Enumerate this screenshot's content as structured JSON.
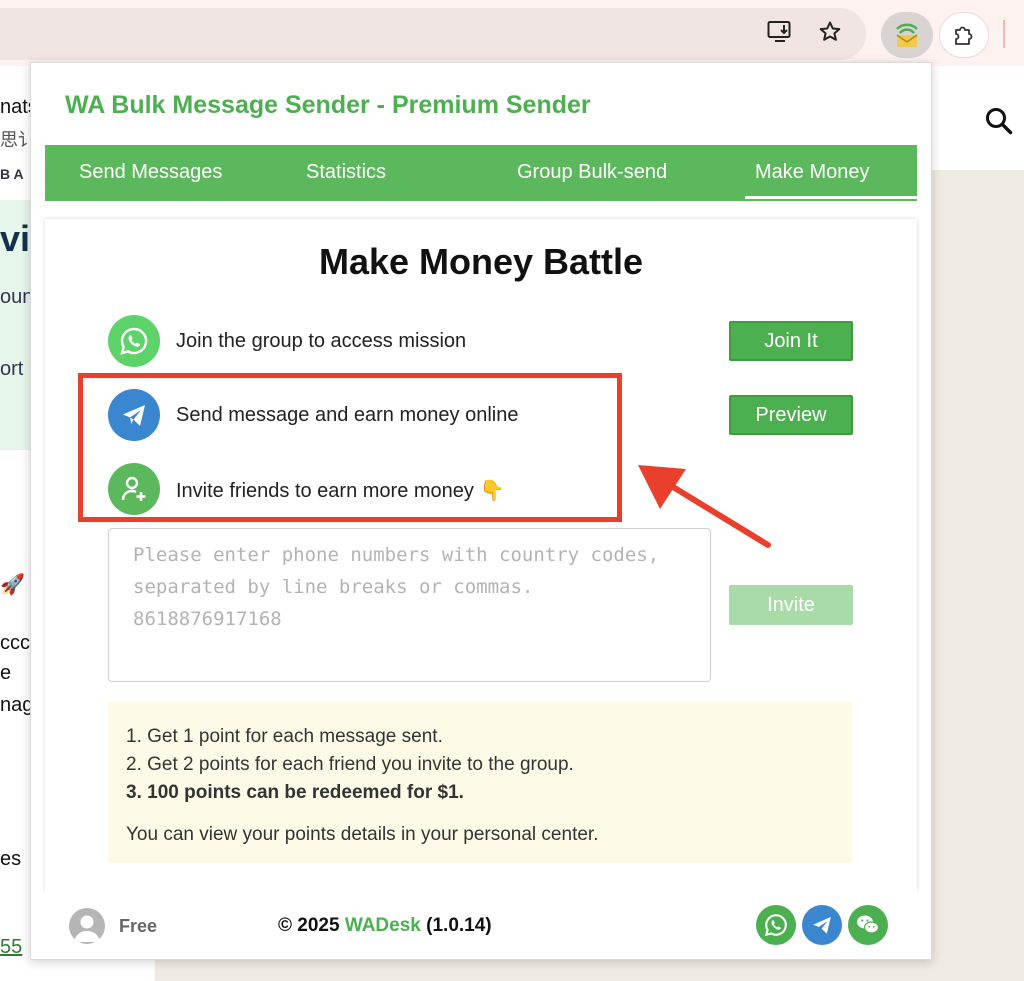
{
  "browser": {
    "icons": [
      "install-app-icon",
      "bookmark-star-icon",
      "wa-extension-icon",
      "extensions-puzzle-icon"
    ]
  },
  "background": {
    "fragments": [
      "nats",
      "思讠",
      "B A",
      "vi",
      "oun",
      "ort",
      "🚀",
      "ccc",
      "e",
      "nag",
      "es",
      "55"
    ],
    "search_icon": "search-icon"
  },
  "header": {
    "title": "WA Bulk Message Sender - Premium Sender"
  },
  "tabs": [
    {
      "label": "Send Messages"
    },
    {
      "label": "Statistics"
    },
    {
      "label": "Group Bulk-send"
    },
    {
      "label": "Make Money",
      "active": true
    }
  ],
  "main": {
    "title": "Make Money Battle",
    "rows": [
      {
        "icon": "whatsapp-icon",
        "label": "Join the group to access mission",
        "button": "Join It"
      },
      {
        "icon": "telegram-send-icon",
        "label": "Send message and earn money online",
        "button": "Preview"
      },
      {
        "icon": "add-user-icon",
        "label": "Invite friends to earn more money",
        "emoji": "👇"
      }
    ],
    "phones_input": {
      "placeholder": "Please enter phone numbers with country codes, separated by line breaks or commas. 8618876917168"
    },
    "invite_button": "Invite",
    "info": {
      "rule1": "1. Get 1 point for each message sent.",
      "rule2": "2. Get 2 points for each friend you invite to the group.",
      "rule3": "3. 100 points can be redeemed for $1.",
      "note": "You can view your points details in your personal center."
    }
  },
  "footer": {
    "plan": "Free",
    "copyright_prefix": "© 2025",
    "brand": "WADesk",
    "version": "(1.0.14)",
    "social_icons": [
      "whatsapp-icon",
      "telegram-icon",
      "wechat-icon"
    ]
  },
  "colors": {
    "brand_green": "#4caf50",
    "tab_green": "#5cb85c",
    "annotation_red": "#e8402c",
    "telegram_blue": "#3a87cf",
    "info_bg": "#fdfbe7"
  }
}
